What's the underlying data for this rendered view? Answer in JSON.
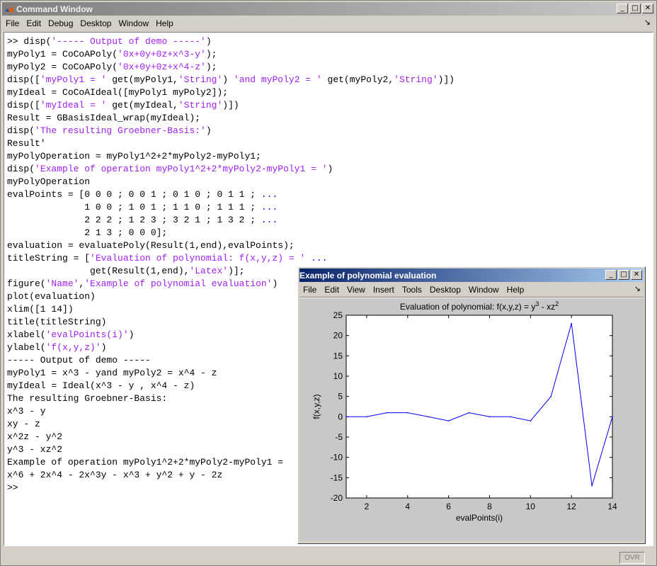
{
  "command_window": {
    "title": "Command Window",
    "menu": [
      "File",
      "Edit",
      "Debug",
      "Desktop",
      "Window",
      "Help"
    ],
    "lines": [
      [
        {
          "t": ">> disp("
        },
        {
          "t": "'----- Output of demo -----'",
          "c": "str"
        },
        {
          "t": ")"
        }
      ],
      [
        {
          "t": "myPoly1 = CoCoAPoly("
        },
        {
          "t": "'0x+0y+0z+x^3-y'",
          "c": "str"
        },
        {
          "t": ");"
        }
      ],
      [
        {
          "t": "myPoly2 = CoCoAPoly("
        },
        {
          "t": "'0x+0y+0z+x^4-z'",
          "c": "str"
        },
        {
          "t": ");"
        }
      ],
      [
        {
          "t": "disp(["
        },
        {
          "t": "'myPoly1 = '",
          "c": "str"
        },
        {
          "t": " get(myPoly1,"
        },
        {
          "t": "'String'",
          "c": "str"
        },
        {
          "t": ") "
        },
        {
          "t": "'and myPoly2 = '",
          "c": "str"
        },
        {
          "t": " get(myPoly2,"
        },
        {
          "t": "'String'",
          "c": "str"
        },
        {
          "t": ")])"
        }
      ],
      [
        {
          "t": "myIdeal = CoCoAIdeal([myPoly1 myPoly2]);"
        }
      ],
      [
        {
          "t": "disp(["
        },
        {
          "t": "'myIdeal = '",
          "c": "str"
        },
        {
          "t": " get(myIdeal,"
        },
        {
          "t": "'String'",
          "c": "str"
        },
        {
          "t": ")])"
        }
      ],
      [
        {
          "t": "Result = GBasisIdeal_wrap(myIdeal);"
        }
      ],
      [
        {
          "t": "disp("
        },
        {
          "t": "'The resulting Groebner-Basis:'",
          "c": "str"
        },
        {
          "t": ")"
        }
      ],
      [
        {
          "t": "Result'"
        }
      ],
      [
        {
          "t": "myPolyOperation = myPoly1^2+2*myPoly2-myPoly1;"
        }
      ],
      [
        {
          "t": "disp("
        },
        {
          "t": "'Example of operation myPoly1^2+2*myPoly2-myPoly1 = '",
          "c": "str"
        },
        {
          "t": ")"
        }
      ],
      [
        {
          "t": "myPolyOperation"
        }
      ],
      [
        {
          "t": "evalPoints = [0 0 0 ; 0 0 1 ; 0 1 0 ; 0 1 1 ; "
        },
        {
          "t": "...",
          "c": "cont"
        }
      ],
      [
        {
          "t": "              1 0 0 ; 1 0 1 ; 1 1 0 ; 1 1 1 ; "
        },
        {
          "t": "...",
          "c": "cont"
        }
      ],
      [
        {
          "t": "              2 2 2 ; 1 2 3 ; 3 2 1 ; 1 3 2 ; "
        },
        {
          "t": "...",
          "c": "cont"
        }
      ],
      [
        {
          "t": "              2 1 3 ; 0 0 0];"
        }
      ],
      [
        {
          "t": "evaluation = evaluatePoly(Result(1,end),evalPoints);"
        }
      ],
      [
        {
          "t": "titleString = ["
        },
        {
          "t": "'Evaluation of polynomial: f(x,y,z) = '",
          "c": "str"
        },
        {
          "t": " "
        },
        {
          "t": "...",
          "c": "cont"
        }
      ],
      [
        {
          "t": "               get(Result(1,end),"
        },
        {
          "t": "'Latex'",
          "c": "str"
        },
        {
          "t": ")];"
        }
      ],
      [
        {
          "t": "figure("
        },
        {
          "t": "'Name'",
          "c": "str"
        },
        {
          "t": ","
        },
        {
          "t": "'Example of polynomial evaluation'",
          "c": "str"
        },
        {
          "t": ")"
        }
      ],
      [
        {
          "t": "plot(evaluation)"
        }
      ],
      [
        {
          "t": "xlim([1 14])"
        }
      ],
      [
        {
          "t": "title(titleString)"
        }
      ],
      [
        {
          "t": "xlabel("
        },
        {
          "t": "'evalPoints(i)'",
          "c": "str"
        },
        {
          "t": ")"
        }
      ],
      [
        {
          "t": "ylabel("
        },
        {
          "t": "'f(x,y,z)'",
          "c": "str"
        },
        {
          "t": ")"
        }
      ],
      [
        {
          "t": "----- Output of demo -----"
        }
      ],
      [
        {
          "t": "myPoly1 = x^3 - yand myPoly2 = x^4 - z"
        }
      ],
      [
        {
          "t": "myIdeal = Ideal(x^3 - y , x^4 - z)"
        }
      ],
      [
        {
          "t": "The resulting Groebner-Basis:"
        }
      ],
      [
        {
          "t": "x^3 - y"
        }
      ],
      [
        {
          "t": "xy - z"
        }
      ],
      [
        {
          "t": "x^2z - y^2"
        }
      ],
      [
        {
          "t": "y^3 - xz^2"
        }
      ],
      [
        {
          "t": "Example of operation myPoly1^2+2*myPoly2-myPoly1 ="
        }
      ],
      [
        {
          "t": "x^6 + 2x^4 - 2x^3y - x^3 + y^2 + y - 2z"
        }
      ],
      [
        {
          "t": ">>"
        }
      ]
    ],
    "status": "OVR"
  },
  "figure_window": {
    "title": "Example of polynomial evaluation",
    "menu": [
      "File",
      "Edit",
      "View",
      "Insert",
      "Tools",
      "Desktop",
      "Window",
      "Help"
    ]
  },
  "chart_data": {
    "type": "line",
    "title": "Evaluation of polynomial: f(x,y,z) = y³ - xz²",
    "title_main": "Evaluation of polynomial: f(x,y,z) = y",
    "title_exp1": "3",
    "title_mid": " - xz",
    "title_exp2": "2",
    "xlabel": "evalPoints(i)",
    "ylabel": "f(x,y,z)",
    "xlim": [
      1,
      14
    ],
    "ylim": [
      -20,
      25
    ],
    "xticks": [
      2,
      4,
      6,
      8,
      10,
      12,
      14
    ],
    "yticks": [
      -20,
      -15,
      -10,
      -5,
      0,
      5,
      10,
      15,
      20,
      25
    ],
    "x": [
      1,
      2,
      3,
      4,
      5,
      6,
      7,
      8,
      9,
      10,
      11,
      12,
      13,
      14
    ],
    "y": [
      0,
      0,
      1,
      1,
      0,
      -1,
      1,
      0,
      0,
      -1,
      5,
      23,
      -17,
      0
    ],
    "line_color": "#0000ff",
    "grid": false
  }
}
